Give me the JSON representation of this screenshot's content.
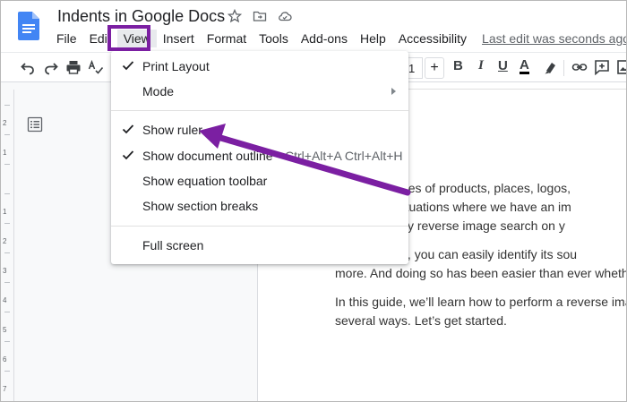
{
  "doc": {
    "title": "Indents in Google Docs"
  },
  "menubar": {
    "items": [
      "File",
      "Edit",
      "View",
      "Insert",
      "Format",
      "Tools",
      "Add-ons",
      "Help",
      "Accessibility"
    ],
    "active": "View",
    "last_edit": "Last edit was seconds ago"
  },
  "toolbar": {
    "font_size": "1",
    "plus": "+",
    "bold": "B",
    "italic": "I",
    "underline": "U",
    "text_color_letter": "A"
  },
  "view_menu": {
    "print_layout": {
      "label": "Print Layout",
      "checked": true
    },
    "mode": {
      "label": "Mode",
      "has_submenu": true
    },
    "show_ruler": {
      "label": "Show ruler",
      "checked": true
    },
    "show_outline": {
      "label": "Show document outline",
      "checked": true,
      "shortcut": "Ctrl+Alt+A Ctrl+Alt+H"
    },
    "show_equation": {
      "label": "Show equation toolbar"
    },
    "show_breaks": {
      "label": "Show section breaks"
    },
    "full_screen": {
      "label": "Full screen"
    }
  },
  "ruler": {
    "vertical_labels": [
      "2",
      "1",
      "1",
      "2",
      "3",
      "4",
      "5",
      "6",
      "7"
    ]
  },
  "page": {
    "lines": [
      "arch for images of products, places, logos,",
      "ss reverse situations where we have an im",
      "doing a handy reverse image search on y",
      "mage search, you can easily identify its sou",
      "more. And doing so has been easier than ever whether y",
      "In this guide, we’ll learn how to perform a reverse image",
      "several ways. Let’s get started."
    ]
  },
  "annotation": {
    "highlight_color": "#7b1fa2",
    "arrow_color": "#7b1fa2",
    "points_to": "Show ruler"
  },
  "colors": {
    "docs_blue": "#4285f4",
    "menu_active_bg": "#e8eaed"
  }
}
